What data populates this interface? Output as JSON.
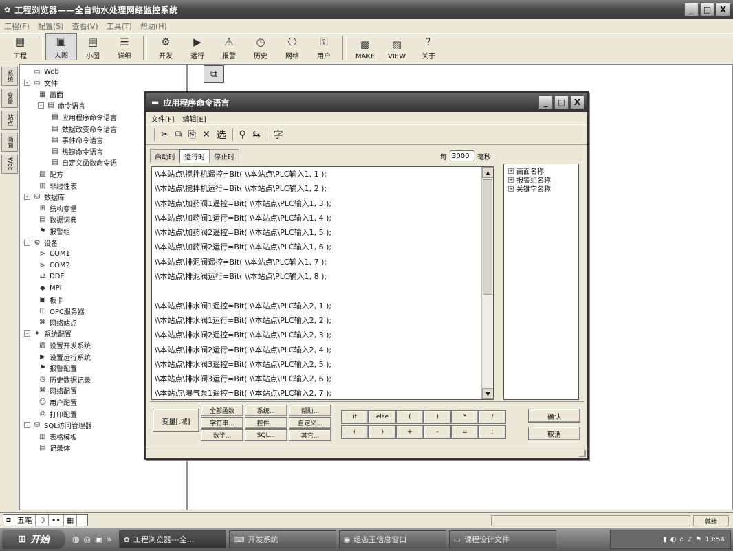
{
  "app": {
    "title": "工程浏览器——全自动水处理网络监控系统",
    "window_buttons": [
      "_",
      "□",
      "X"
    ]
  },
  "menu": [
    "工程(F)",
    "配置(S)",
    "查看(V)",
    "工具(T)",
    "帮助(H)"
  ],
  "toolbar": [
    "工程",
    "大图",
    "小图",
    "详细",
    "开发",
    "运行",
    "报警",
    "历史",
    "网络",
    "用户",
    "MAKE",
    "VIEW",
    "关于"
  ],
  "vstrip": [
    "系统",
    "变量",
    "站点",
    "画面",
    "Web"
  ],
  "tree": [
    {
      "label": "Web",
      "icon": "folder",
      "level": 1
    },
    {
      "label": "文件",
      "icon": "folder",
      "level": 1,
      "toggle": "-"
    },
    {
      "label": "画面",
      "icon": "screen",
      "level": 2
    },
    {
      "label": "命令语言",
      "icon": "doc",
      "level": 2,
      "toggle": "-"
    },
    {
      "label": "应用程序命令语言",
      "icon": "doc",
      "level": 3
    },
    {
      "label": "数据改变命令语言",
      "icon": "doc",
      "level": 3
    },
    {
      "label": "事件命令语言",
      "icon": "doc",
      "level": 3
    },
    {
      "label": "热键命令语言",
      "icon": "doc",
      "level": 3
    },
    {
      "label": "自定义函数命令语",
      "icon": "doc",
      "level": 3
    },
    {
      "label": "配方",
      "icon": "recipe",
      "level": 2
    },
    {
      "label": "非线性表",
      "icon": "table",
      "level": 2
    },
    {
      "label": "数据库",
      "icon": "db",
      "level": 1,
      "toggle": "-"
    },
    {
      "label": "结构变量",
      "icon": "var",
      "level": 2
    },
    {
      "label": "数据词典",
      "icon": "dict",
      "level": 2
    },
    {
      "label": "报警组",
      "icon": "alarm",
      "level": 2
    },
    {
      "label": "设备",
      "icon": "device",
      "level": 1,
      "toggle": "-"
    },
    {
      "label": "COM1",
      "icon": "com",
      "level": 2
    },
    {
      "label": "COM2",
      "icon": "com",
      "level": 2
    },
    {
      "label": "DDE",
      "icon": "dde",
      "level": 2
    },
    {
      "label": "MPI",
      "icon": "mpi",
      "level": 2
    },
    {
      "label": "板卡",
      "icon": "card",
      "level": 2
    },
    {
      "label": "OPC服务器",
      "icon": "opc",
      "level": 2
    },
    {
      "label": "网络站点",
      "icon": "net",
      "level": 2
    },
    {
      "label": "系统配置",
      "icon": "cfg",
      "level": 1,
      "toggle": "-"
    },
    {
      "label": "设置开发系统",
      "icon": "dev",
      "level": 2
    },
    {
      "label": "设置运行系统",
      "icon": "run",
      "level": 2
    },
    {
      "label": "报警配置",
      "icon": "alarm",
      "level": 2
    },
    {
      "label": "历史数据记录",
      "icon": "hist",
      "level": 2
    },
    {
      "label": "网络配置",
      "icon": "net",
      "level": 2
    },
    {
      "label": "用户配置",
      "icon": "user",
      "level": 2
    },
    {
      "label": "打印配置",
      "icon": "print",
      "level": 2
    },
    {
      "label": "SQL访问管理器",
      "icon": "sql",
      "level": 1,
      "toggle": "-"
    },
    {
      "label": "表格模板",
      "icon": "table",
      "level": 2
    },
    {
      "label": "记录体",
      "icon": "doc",
      "level": 2
    }
  ],
  "dialog": {
    "title": "应用程序命令语言",
    "menu": [
      "文件[F]",
      "编辑[E]"
    ],
    "toolbar": [
      "✂",
      "⧉",
      "⎘",
      "✕",
      "选",
      "⚲",
      "⇆",
      "字"
    ],
    "tabs": [
      "启动时",
      "运行时",
      "停止时"
    ],
    "selected_tab": "运行时",
    "period_prefix": "每",
    "period_value": "3000",
    "period_unit": "毫秒",
    "code_lines": [
      "\\\\本站点\\搅拌机遥控=Bit( \\\\本站点\\PLC输入1, 1 );",
      "\\\\本站点\\搅拌机运行=Bit( \\\\本站点\\PLC输入1, 2 );",
      "\\\\本站点\\加药阀1遥控=Bit( \\\\本站点\\PLC输入1, 3 );",
      "\\\\本站点\\加药阀1运行=Bit( \\\\本站点\\PLC输入1, 4 );",
      "\\\\本站点\\加药阀2遥控=Bit( \\\\本站点\\PLC输入1, 5 );",
      "\\\\本站点\\加药阀2运行=Bit( \\\\本站点\\PLC输入1, 6 );",
      "\\\\本站点\\排泥阀遥控=Bit( \\\\本站点\\PLC输入1, 7 );",
      "\\\\本站点\\排泥阀运行=Bit( \\\\本站点\\PLC输入1, 8 );",
      "",
      "\\\\本站点\\排水阀1遥控=Bit( \\\\本站点\\PLC输入2, 1 );",
      "\\\\本站点\\排水阀1运行=Bit( \\\\本站点\\PLC输入2, 2 );",
      "\\\\本站点\\排水阀2遥控=Bit( \\\\本站点\\PLC输入2, 3 );",
      "\\\\本站点\\排水阀2运行=Bit( \\\\本站点\\PLC输入2, 4 );",
      "\\\\本站点\\排水阀3遥控=Bit( \\\\本站点\\PLC输入2, 5 );",
      "\\\\本站点\\排水阀3运行=Bit( \\\\本站点\\PLC输入2, 6 );",
      "\\\\本站点\\曝气泵1遥控=Bit( \\\\本站点\\PLC输入2, 7 );"
    ],
    "side_tree": [
      "画面名称",
      "报警组名称",
      "关键字名称"
    ],
    "var_button": "变量[.域]",
    "func_buttons": [
      "全部函数",
      "系统...",
      "帮助...",
      "字符串...",
      "控件...",
      "自定义...",
      "数学...",
      "SQL...",
      "其它..."
    ],
    "op_row1": [
      "if",
      "else",
      "(",
      ")",
      "*",
      "/"
    ],
    "op_row2": [
      "{",
      "}",
      "+",
      "-",
      "=",
      ";"
    ],
    "ok": "确认",
    "cancel": "取消"
  },
  "bottom": {
    "ime": "五笔",
    "status": "就绪"
  },
  "taskbar": {
    "start": "开始",
    "tasks": [
      "工程浏览器---全...",
      "开发系统",
      "组态王信息窗口",
      "课程设计文件"
    ],
    "time": "13:54"
  }
}
